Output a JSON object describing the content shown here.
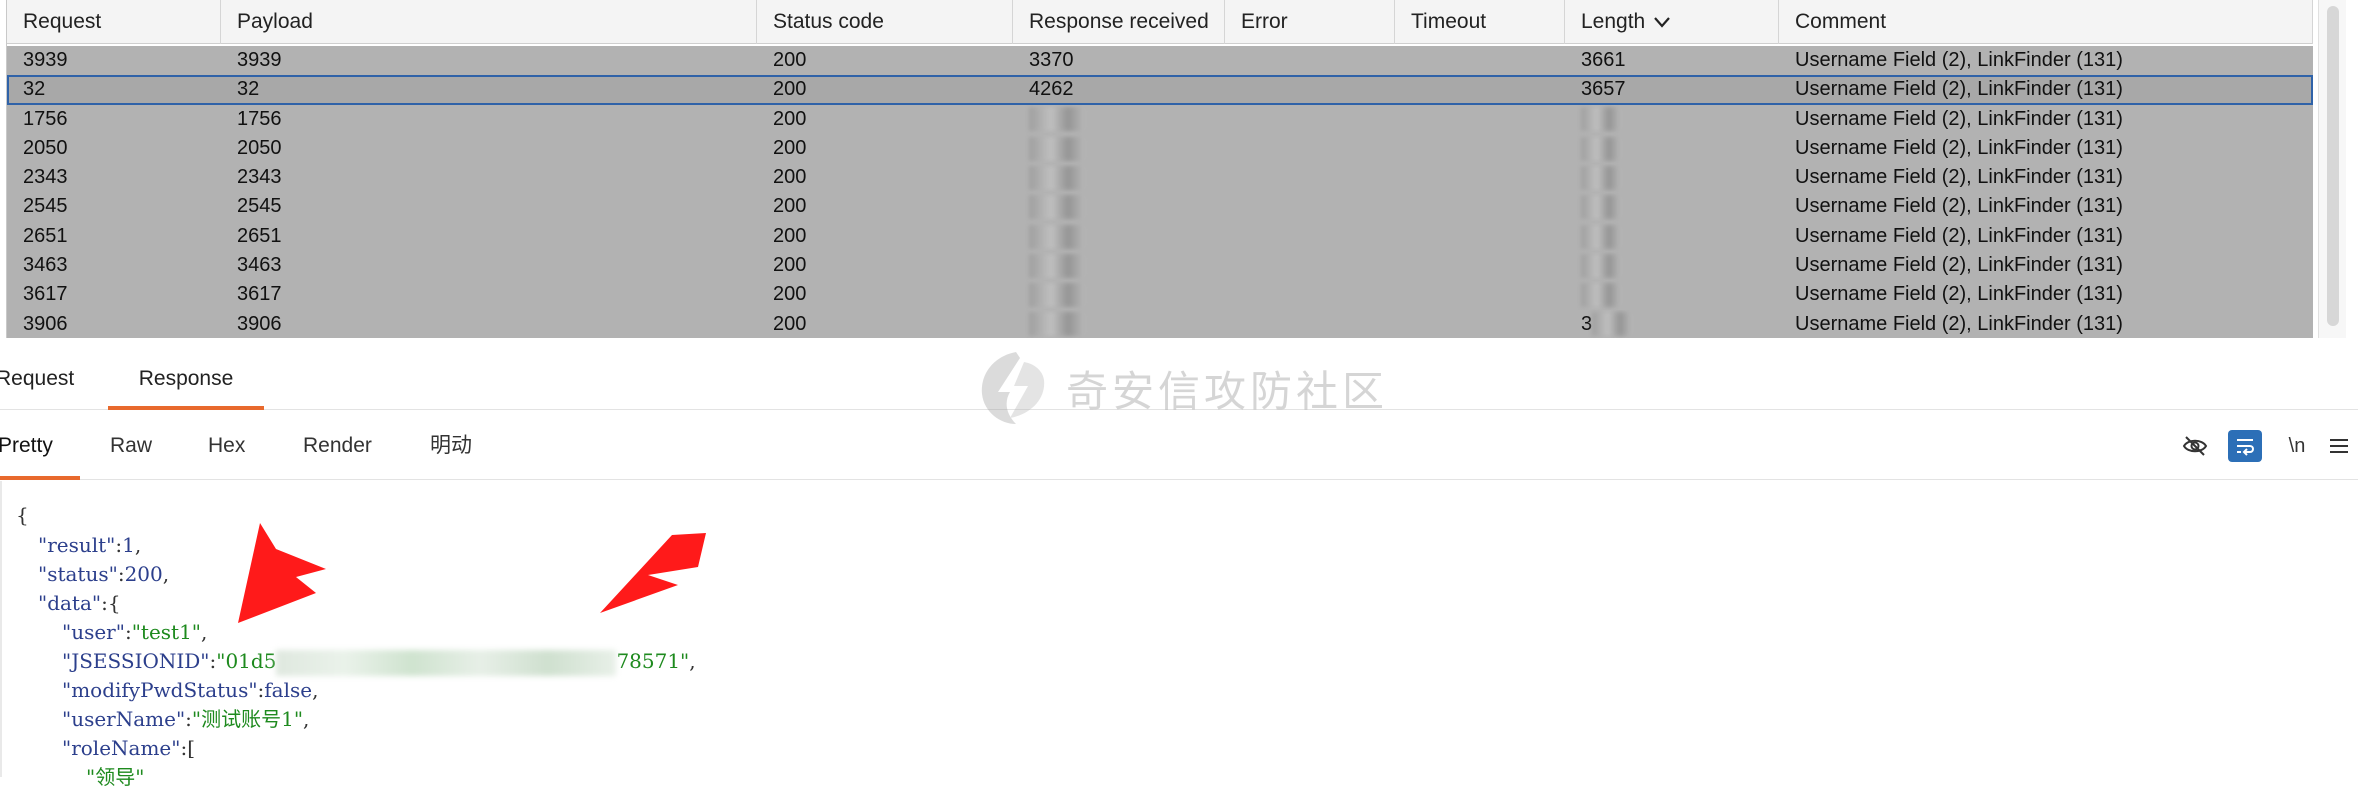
{
  "table": {
    "columns": [
      "Request",
      "Payload",
      "Status code",
      "Response received",
      "Error",
      "Timeout",
      "Length",
      "Comment"
    ],
    "sorted_column": "Length",
    "rows": [
      {
        "request": "3939",
        "payload": "3939",
        "status": "200",
        "received": "3370",
        "error": "",
        "timeout": "",
        "length": "3661",
        "comment": "Username Field (2), LinkFinder (131)",
        "selected": false,
        "blurred": false
      },
      {
        "request": "32",
        "payload": "32",
        "status": "200",
        "received": "4262",
        "error": "",
        "timeout": "",
        "length": "3657",
        "comment": "Username Field (2), LinkFinder (131)",
        "selected": true,
        "blurred": false
      },
      {
        "request": "1756",
        "payload": "1756",
        "status": "200",
        "received": "",
        "error": "",
        "timeout": "",
        "length": "",
        "comment": "Username Field (2), LinkFinder (131)",
        "selected": false,
        "blurred": true
      },
      {
        "request": "2050",
        "payload": "2050",
        "status": "200",
        "received": "",
        "error": "",
        "timeout": "",
        "length": "",
        "comment": "Username Field (2), LinkFinder (131)",
        "selected": false,
        "blurred": true
      },
      {
        "request": "2343",
        "payload": "2343",
        "status": "200",
        "received": "",
        "error": "",
        "timeout": "",
        "length": "",
        "comment": "Username Field (2), LinkFinder (131)",
        "selected": false,
        "blurred": true
      },
      {
        "request": "2545",
        "payload": "2545",
        "status": "200",
        "received": "",
        "error": "",
        "timeout": "",
        "length": "",
        "comment": "Username Field (2), LinkFinder (131)",
        "selected": false,
        "blurred": true
      },
      {
        "request": "2651",
        "payload": "2651",
        "status": "200",
        "received": "",
        "error": "",
        "timeout": "",
        "length": "",
        "comment": "Username Field (2), LinkFinder (131)",
        "selected": false,
        "blurred": true
      },
      {
        "request": "3463",
        "payload": "3463",
        "status": "200",
        "received": "",
        "error": "",
        "timeout": "",
        "length": "",
        "comment": "Username Field (2), LinkFinder (131)",
        "selected": false,
        "blurred": true
      },
      {
        "request": "3617",
        "payload": "3617",
        "status": "200",
        "received": "",
        "error": "",
        "timeout": "",
        "length": "",
        "comment": "Username Field (2), LinkFinder (131)",
        "selected": false,
        "blurred": true
      },
      {
        "request": "3906",
        "payload": "3906",
        "status": "200",
        "received": "",
        "error": "",
        "timeout": "",
        "length": "3",
        "comment": "Username Field (2), LinkFinder (131)",
        "selected": false,
        "blurred": true
      }
    ]
  },
  "watermark": {
    "text": "奇安信攻防社区",
    "icon": "qianxin-logo-icon"
  },
  "main_tabs": [
    {
      "label": "Request",
      "active": false
    },
    {
      "label": "Response",
      "active": true
    }
  ],
  "view_tabs": [
    {
      "label": "Pretty",
      "active": true
    },
    {
      "label": "Raw",
      "active": false
    },
    {
      "label": "Hex",
      "active": false
    },
    {
      "label": "Render",
      "active": false
    },
    {
      "label": "明动",
      "active": false
    }
  ],
  "toolbar": {
    "hide_icon": "eye-slash-icon",
    "wrap_icon": "word-wrap-icon",
    "newline_label": "\\n",
    "menu_icon": "hamburger-menu-icon"
  },
  "response_json": {
    "open_brace": "{",
    "result_key": "\"result\"",
    "result_val": "1",
    "status_key": "\"status\"",
    "status_val": "200",
    "data_key": "\"data\"",
    "user_key": "\"user\"",
    "user_val": "\"test1\"",
    "session_key": "\"JSESSIONID\"",
    "session_prefix": "\"01d5",
    "session_suffix": "78571\"",
    "modify_key": "\"modifyPwdStatus\"",
    "modify_val": "false",
    "username_key": "\"userName\"",
    "username_val": "\"测试账号1\"",
    "rolename_key": "\"roleName\"",
    "role_partial": "\"领导\""
  },
  "colors": {
    "accent": "#e8692d",
    "selected_outline": "#2f62a8",
    "row_bg": "#b2b2b2",
    "arrow": "#ff1a1a",
    "json_key": "#2c3f8c",
    "json_string": "#1e8a1e"
  }
}
